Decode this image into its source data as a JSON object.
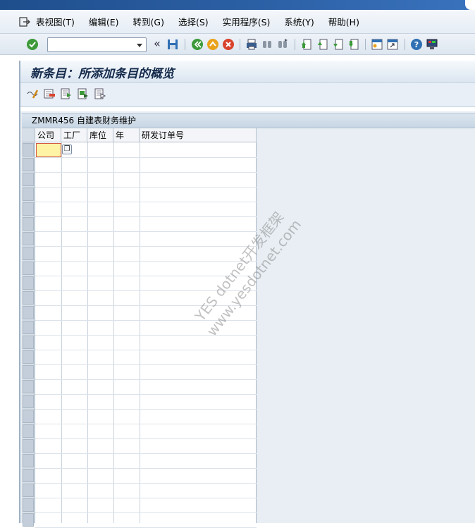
{
  "menubar": {
    "items": [
      "表视图(T)",
      "编辑(E)",
      "转到(G)",
      "选择(S)",
      "实用程序(S)",
      "系统(Y)",
      "帮助(H)"
    ]
  },
  "toolbar": {
    "command_field": "",
    "icons": [
      "enter-check-icon",
      "save-icon",
      "back-icon",
      "exit-icon",
      "cancel-icon",
      "print-icon",
      "find-icon",
      "find-next-icon",
      "first-page-icon",
      "prev-page-icon",
      "next-page-icon",
      "last-page-icon",
      "new-session-icon",
      "shortcut-icon",
      "help-icon",
      "customize-layout-icon"
    ]
  },
  "page": {
    "title": "新条目：所添加条目的概览"
  },
  "app_toolbar": {
    "icons": [
      "change-display-icon",
      "delete-icon",
      "select-all-icon",
      "select-block-icon",
      "deselect-all-icon"
    ]
  },
  "table": {
    "caption": "ZMMR456 自建表财务维护",
    "columns": [
      "公司",
      "工厂",
      "库位",
      "年",
      "研发订单号"
    ],
    "rows_visible": 26
  },
  "watermark": {
    "line1": "YES dotnet开发框架",
    "line2": "www.yesdotnet.com"
  }
}
